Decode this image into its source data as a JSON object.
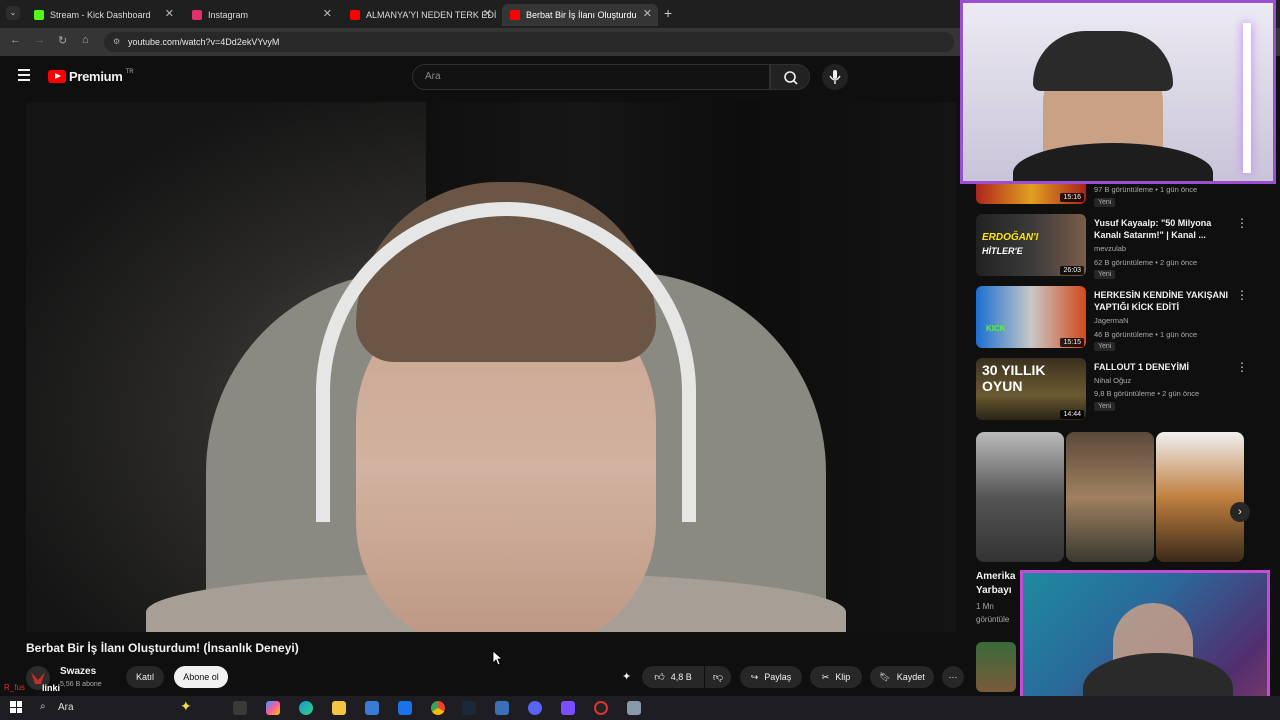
{
  "browser": {
    "tabs": [
      {
        "title": "Stream - Kick Dashboard",
        "color": "#53fc18"
      },
      {
        "title": "Instagram",
        "color": "#e1306c"
      },
      {
        "title": "ALMANYA'YI NEDEN TERK EDİ",
        "color": "#ff0000"
      },
      {
        "title": "Berbat Bir İş İlanı Oluşturdu",
        "color": "#ff0000"
      }
    ],
    "url": "youtube.com/watch?v=4Dd2ekVYvyM"
  },
  "youtube": {
    "logo": "Premium",
    "region": "TR",
    "search_placeholder": "Ara"
  },
  "video": {
    "title": "Berbat Bir İş İlanı Oluşturdum! (İnsanlık Deneyi)",
    "channel": "Swazes",
    "subscribers": "5,56 B abone",
    "join_label": "Katıl",
    "subscribe_label": "Abone ol",
    "likes": "4,8 B",
    "share_label": "Paylaş",
    "clip_label": "Klip",
    "save_label": "Kaydet"
  },
  "recommendations": [
    {
      "title": "",
      "channel": "",
      "views": "97 B görüntüleme • 1 gün önce",
      "badge": "Yeni",
      "duration": "15:16"
    },
    {
      "title": "Yusuf Kayaalp: \"50 Milyona Kanalı Satarım!\" | Kanal ...",
      "channel": "mevzulab",
      "views": "62 B görüntüleme • 2 gün önce",
      "badge": "Yeni",
      "duration": "26:03"
    },
    {
      "title": "HERKESİN KENDİNE YAKIŞANI YAPTIĞI KİCK EDİTİ",
      "channel": "JagermaN",
      "views": "46 B görüntüleme • 1 gün önce",
      "badge": "Yeni",
      "duration": "15:15"
    },
    {
      "title": "FALLOUT 1 DENEYİMİ",
      "channel": "Nihal Oğuz",
      "views": "9,8 B görüntüleme • 2 gün önce",
      "badge": "Yeni",
      "duration": "14:44"
    }
  ],
  "partial_rec": {
    "title_line1": "Amerika",
    "title_line2": "Yarbayı",
    "views_line1": "1 Mn",
    "views_line2": "görüntüle"
  },
  "taskbar": {
    "search_label": "Ara"
  },
  "overlay_text": {
    "chat_label": "R_fus",
    "link_label": "linki"
  }
}
